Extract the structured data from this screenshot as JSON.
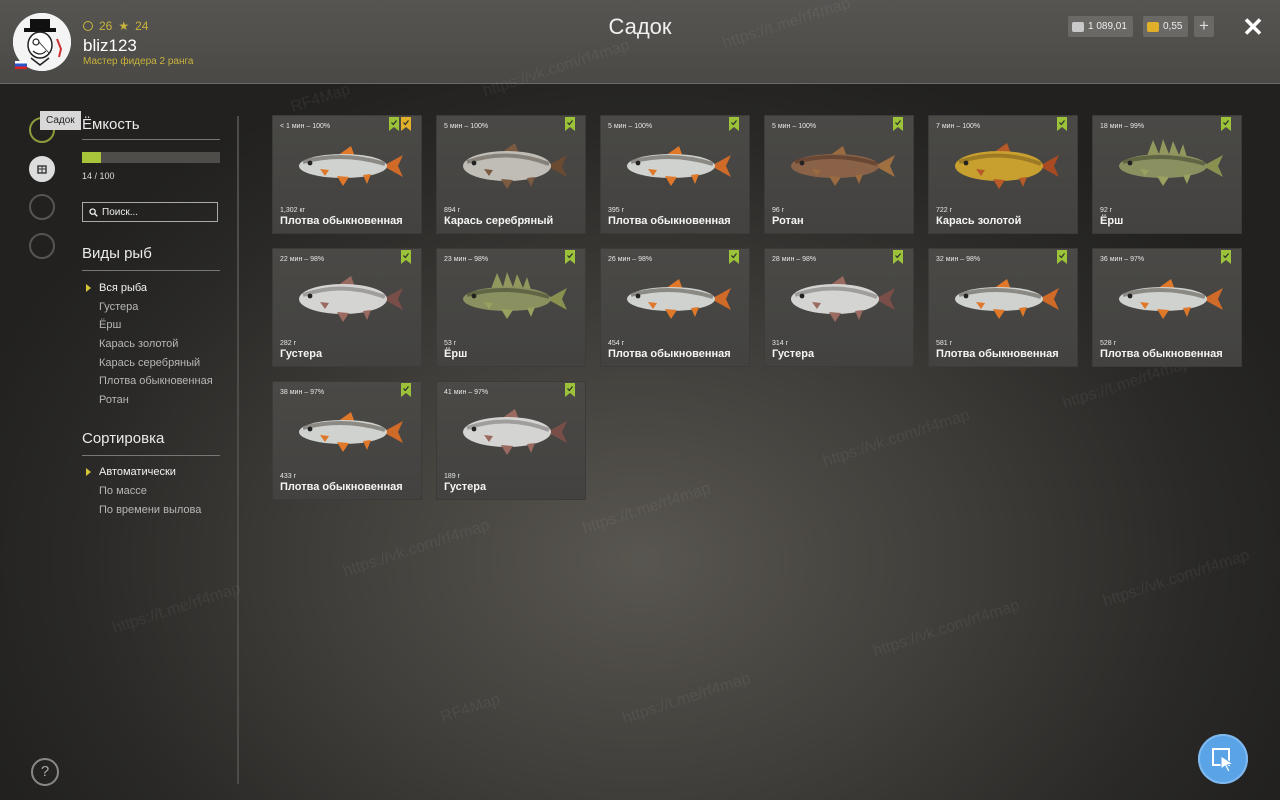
{
  "header": {
    "title": "Садок",
    "username": "bliz123",
    "rank": "Мастер фидера 2 ранга",
    "level": "26",
    "stars": "24",
    "silver": "1 089,01",
    "gold": "0,55",
    "plus_label": "+",
    "close_label": "✕"
  },
  "tooltip": "Садок",
  "capacity": {
    "title": "Ёмкость",
    "text": "14 / 100",
    "fraction": 0.14
  },
  "search": {
    "placeholder": "Поиск..."
  },
  "species": {
    "title": "Виды рыб",
    "items": [
      "Вся рыба",
      "Густера",
      "Ёрш",
      "Карась золотой",
      "Карась серебряный",
      "Плотва обыкновенная",
      "Ротан"
    ]
  },
  "sort": {
    "title": "Сортировка",
    "items": [
      "Автоматически",
      "По массе",
      "По времени вылова"
    ]
  },
  "fish": [
    {
      "time": "< 1 мин – 100%",
      "weight": "1,302 кг",
      "name": "Плотва обыкновенная",
      "type": "roach",
      "bookmarks": 2
    },
    {
      "time": "5 мин – 100%",
      "weight": "894 г",
      "name": "Карась серебряный",
      "type": "silver",
      "bookmarks": 1
    },
    {
      "time": "5 мин – 100%",
      "weight": "395 г",
      "name": "Плотва обыкновенная",
      "type": "roach",
      "bookmarks": 1
    },
    {
      "time": "5 мин – 100%",
      "weight": "96 г",
      "name": "Ротан",
      "type": "rotan",
      "bookmarks": 1
    },
    {
      "time": "7 мин – 100%",
      "weight": "722 г",
      "name": "Карась золотой",
      "type": "gold",
      "bookmarks": 1
    },
    {
      "time": "18 мин – 99%",
      "weight": "92 г",
      "name": "Ёрш",
      "type": "ruffe",
      "bookmarks": 1
    },
    {
      "time": "22 мин – 98%",
      "weight": "282 г",
      "name": "Густера",
      "type": "bream",
      "bookmarks": 1
    },
    {
      "time": "23 мин – 98%",
      "weight": "53 г",
      "name": "Ёрш",
      "type": "ruffe",
      "bookmarks": 1
    },
    {
      "time": "26 мин – 98%",
      "weight": "454 г",
      "name": "Плотва обыкновенная",
      "type": "roach",
      "bookmarks": 1
    },
    {
      "time": "28 мин – 98%",
      "weight": "314 г",
      "name": "Густера",
      "type": "bream",
      "bookmarks": 1
    },
    {
      "time": "32 мин – 98%",
      "weight": "581 г",
      "name": "Плотва обыкновенная",
      "type": "roach",
      "bookmarks": 1
    },
    {
      "time": "36 мин – 97%",
      "weight": "528 г",
      "name": "Плотва обыкновенная",
      "type": "roach",
      "bookmarks": 1
    },
    {
      "time": "38 мин – 97%",
      "weight": "433 г",
      "name": "Плотва обыкновенная",
      "type": "roach",
      "bookmarks": 1
    },
    {
      "time": "41 мин – 97%",
      "weight": "189 г",
      "name": "Густера",
      "type": "bream",
      "bookmarks": 1
    }
  ],
  "watermarks": [
    "RF4Map",
    "https://vk.com/rf4map",
    "https://t.me/rf4map"
  ],
  "colors": {
    "accent": "#a8c43a",
    "gold_text": "#c9b33c",
    "bookmark_green": "#9cc23a",
    "bookmark_gold": "#e0b02a",
    "fab": "#5aa3e6"
  },
  "icons": {
    "rail": [
      "map-icon",
      "fishnet-icon",
      "campfire-icon",
      "home-icon"
    ],
    "help": "?"
  }
}
